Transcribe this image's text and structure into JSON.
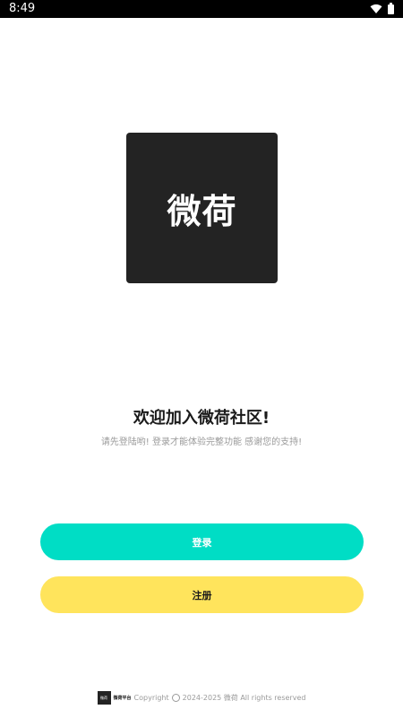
{
  "status_bar": {
    "time": "8:49",
    "icons": [
      "wifi-icon",
      "battery-icon"
    ]
  },
  "logo": {
    "text": "微荷"
  },
  "welcome": {
    "title": "欢迎加入微荷社区!",
    "subtitle": "请先登陆哟! 登录才能体验完整功能 感谢您的支持!"
  },
  "buttons": {
    "login_label": "登录",
    "register_label": "注册"
  },
  "footer": {
    "logo_text": "微荷",
    "brand": "微荷平台",
    "copyright_prefix": "Copyright",
    "copyright_text": "2024-2025 微荷 All rights reserved"
  },
  "colors": {
    "login_button": "#00ddc5",
    "register_button": "#ffe45c",
    "logo_background": "#232323",
    "status_bar": "#000000"
  }
}
